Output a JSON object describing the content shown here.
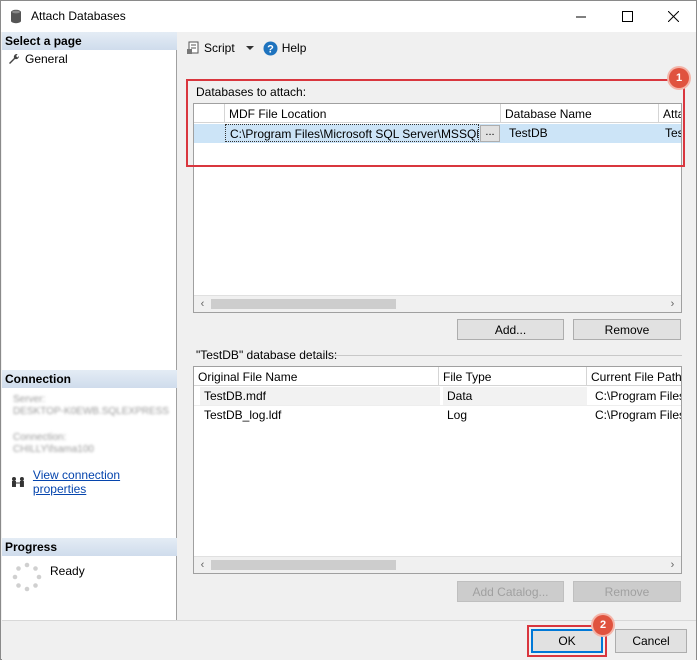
{
  "window": {
    "title": "Attach Databases"
  },
  "leftpane": {
    "select_page_header": "Select a page",
    "general_label": "General",
    "connection_header": "Connection",
    "server_label": "Server:",
    "server_value": "DESKTOP-K0EWB.SQLEXPRESS",
    "connection_label": "Connection:",
    "connection_value": "CHILLY\\fsama100",
    "view_conn_link": "View connection properties",
    "progress_header": "Progress",
    "progress_status": "Ready"
  },
  "toolbar": {
    "script_label": "Script",
    "help_label": "Help"
  },
  "attach": {
    "group_label": "Databases to attach:",
    "columns": [
      "",
      "MDF File Location",
      "Database Name",
      "Atta"
    ],
    "rows": [
      {
        "mdf": "C:\\Program Files\\Microsoft SQL Server\\MSSQL...",
        "browse": "...",
        "dbname": "TestDB",
        "attach_as": "Tes"
      }
    ],
    "add_button": "Add...",
    "remove_button": "Remove",
    "badge": "1"
  },
  "details": {
    "group_label": "\"TestDB\" database details:",
    "columns": [
      "Original File Name",
      "File Type",
      "Current File Path"
    ],
    "rows": [
      {
        "file": "TestDB.mdf",
        "type": "Data",
        "path": "C:\\Program Files\\M"
      },
      {
        "file": "TestDB_log.ldf",
        "type": "Log",
        "path": "C:\\Program Files\\M"
      }
    ],
    "add_catalog_button": "Add Catalog...",
    "remove_button": "Remove"
  },
  "footer": {
    "ok_button": "OK",
    "cancel_button": "Cancel",
    "badge": "2"
  },
  "colors": {
    "accent_red": "#d9363e",
    "selection": "#cce4f7",
    "header_gradient": "#cfdcec"
  }
}
